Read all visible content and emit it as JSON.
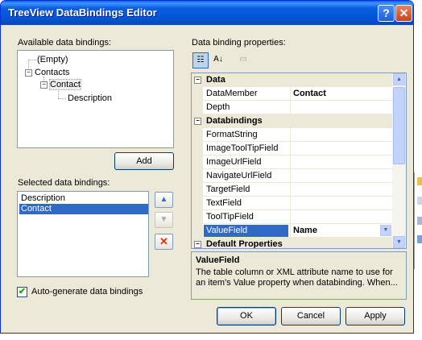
{
  "window": {
    "title": "TreeView DataBindings Editor",
    "help_glyph": "?",
    "close_glyph": "✕"
  },
  "available": {
    "label": "Available data bindings:",
    "nodes": [
      {
        "text": "(Empty)"
      },
      {
        "text": "Contacts",
        "toggle": "−"
      },
      {
        "text": "Contact",
        "toggle": "−"
      },
      {
        "text": "Description"
      }
    ],
    "add_label": "Add"
  },
  "selected": {
    "label": "Selected data bindings:",
    "items": [
      "Description",
      "Contact"
    ],
    "selected_index": 1,
    "up_glyph": "▲",
    "down_glyph": "▼",
    "delete_glyph": "✕"
  },
  "autogen": {
    "label": "Auto-generate data bindings",
    "checked": true,
    "check_glyph": "✔"
  },
  "properties": {
    "label": "Data binding properties:",
    "toolbar": {
      "categorized_glyph": "☷",
      "alpha_glyph": "A↓",
      "pages_glyph": "▭"
    },
    "rows": [
      {
        "kind": "cat",
        "name": "Data",
        "toggle": "−"
      },
      {
        "kind": "prop",
        "name": "DataMember",
        "value": "Contact"
      },
      {
        "kind": "prop",
        "name": "Depth",
        "value": ""
      },
      {
        "kind": "cat",
        "name": "Databindings",
        "toggle": "−"
      },
      {
        "kind": "prop",
        "name": "FormatString",
        "value": ""
      },
      {
        "kind": "prop",
        "name": "ImageToolTipField",
        "value": ""
      },
      {
        "kind": "prop",
        "name": "ImageUrlField",
        "value": ""
      },
      {
        "kind": "prop",
        "name": "NavigateUrlField",
        "value": ""
      },
      {
        "kind": "prop",
        "name": "TargetField",
        "value": ""
      },
      {
        "kind": "prop",
        "name": "TextField",
        "value": ""
      },
      {
        "kind": "prop",
        "name": "ToolTipField",
        "value": ""
      },
      {
        "kind": "prop",
        "name": "ValueField",
        "value": "Name",
        "selected": true
      },
      {
        "kind": "cat",
        "name": "Default Properties",
        "toggle": "−"
      }
    ],
    "dropdown_glyph": "▼",
    "scroll_up_glyph": "▲",
    "scroll_down_glyph": "▼",
    "help": {
      "title": "ValueField",
      "description": "The table column or XML attribute name to use for an item's Value property when databinding. When..."
    }
  },
  "buttons": {
    "ok": "OK",
    "cancel": "Cancel",
    "apply": "Apply"
  }
}
